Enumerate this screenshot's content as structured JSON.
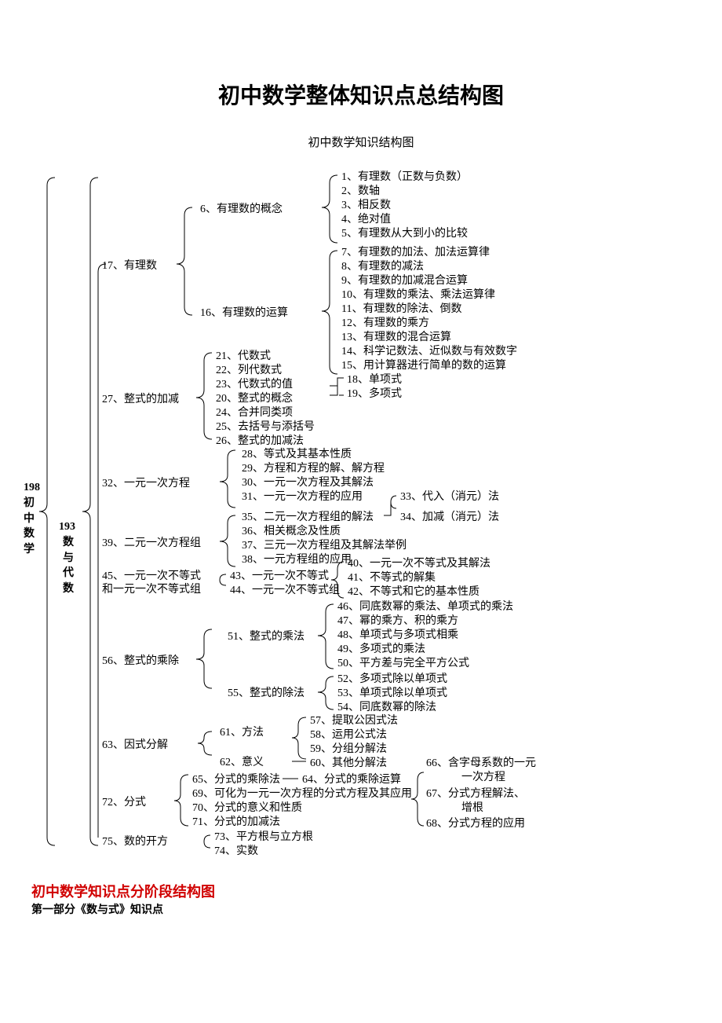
{
  "title": "初中数学整体知识点总结构图",
  "subtitle": "初中数学知识结构图",
  "root": {
    "num": "198",
    "label": [
      "初",
      "中",
      "数",
      "学"
    ]
  },
  "level1": {
    "num": "193",
    "label": [
      "数",
      "与",
      "代",
      "数"
    ]
  },
  "nodes": {
    "n17": "17、有理数",
    "n27": "27、整式的加减",
    "n32": "32、一元一次方程",
    "n39": "39、二元一次方程组",
    "n45a": "45、一元一次不等式",
    "n45b": "和一元一次不等式组",
    "n56": "56、整式的乘除",
    "n63": "63、因式分解",
    "n72": "72、分式",
    "n75": "75、数的开方",
    "n6": "6、有理数的概念",
    "n16": "16、有理数的运算",
    "n21": "21、代数式",
    "n22": "22、列代数式",
    "n23": "23、代数式的值",
    "n20": "20、整式的概念",
    "n24": "24、合并同类项",
    "n25": "25、去括号与添括号",
    "n26": "26、整式的加减法",
    "n28": "28、等式及其基本性质",
    "n29": "29、方程和方程的解、解方程",
    "n30": "30、一元一次方程及其解法",
    "n31": "31、一元一次方程的应用",
    "n35": "35、二元一次方程组的解法",
    "n36": "36、相关概念及性质",
    "n37": "37、三元一次方程组及其解法举例",
    "n38": "38、一元方程组的应用",
    "n43": "43、一元一次不等式",
    "n44": "44、一元一次不等式组",
    "n51": "51、整式的乘法",
    "n55": "55、整式的除法",
    "n61": "61、方法",
    "n62": "62、意义",
    "n65": "65、分式的乘除法",
    "n69": "69、可化为一元一次方程的分式方程及其应用",
    "n70": "70、分式的意义和性质",
    "n71": "71、分式的加减法",
    "n73": "73、平方根与立方根",
    "n74": "74、实数",
    "n1": "1、有理数（正数与负数）",
    "n2": "2、数轴",
    "n3": "3、相反数",
    "n4": "4、绝对值",
    "n5": "5、有理数从大到小的比较",
    "n7": "7、有理数的加法、加法运算律",
    "n8": "8、有理数的减法",
    "n9": "9、有理数的加减混合运算",
    "n10": "10、有理数的乘法、乘法运算律",
    "n11": "11、有理数的除法、倒数",
    "n12": "12、有理数的乘方",
    "n13": "13、有理数的混合运算",
    "n14": "14、科学记数法、近似数与有效数字",
    "n15": "15、用计算器进行简单的数的运算",
    "n18": "18、单项式",
    "n19": "19、多项式",
    "n33": "33、代入（消元）法",
    "n34": "34、加减（消元）法",
    "n40": "40、一元一次不等式及其解法",
    "n41": "41、不等式的解集",
    "n42": "42、不等式和它的基本性质",
    "n46": "46、同底数幂的乘法、单项式的乘法",
    "n47": "47、幂的乘方、积的乘方",
    "n48": "48、单项式与多项式相乘",
    "n49": "49、多项式的乘法",
    "n50": "50、平方差与完全平方公式",
    "n52": "52、多项式除以单项式",
    "n53": "53、单项式除以单项式",
    "n54": "54、同底数幂的除法",
    "n57": "57、提取公因式法",
    "n58": "58、运用公式法",
    "n59": "59、分组分解法",
    "n60": "60、其他分解法",
    "n64": "64、分式的乘除运算",
    "n66a": "66、含字母系数的一元",
    "n66b": "一次方程",
    "n67a": "67、分式方程解法、",
    "n67b": "增根",
    "n68": "68、分式方程的应用"
  },
  "section2": {
    "title": "初中数学知识点分阶段结构图",
    "sub": "第一部分《数与式》知识点"
  }
}
